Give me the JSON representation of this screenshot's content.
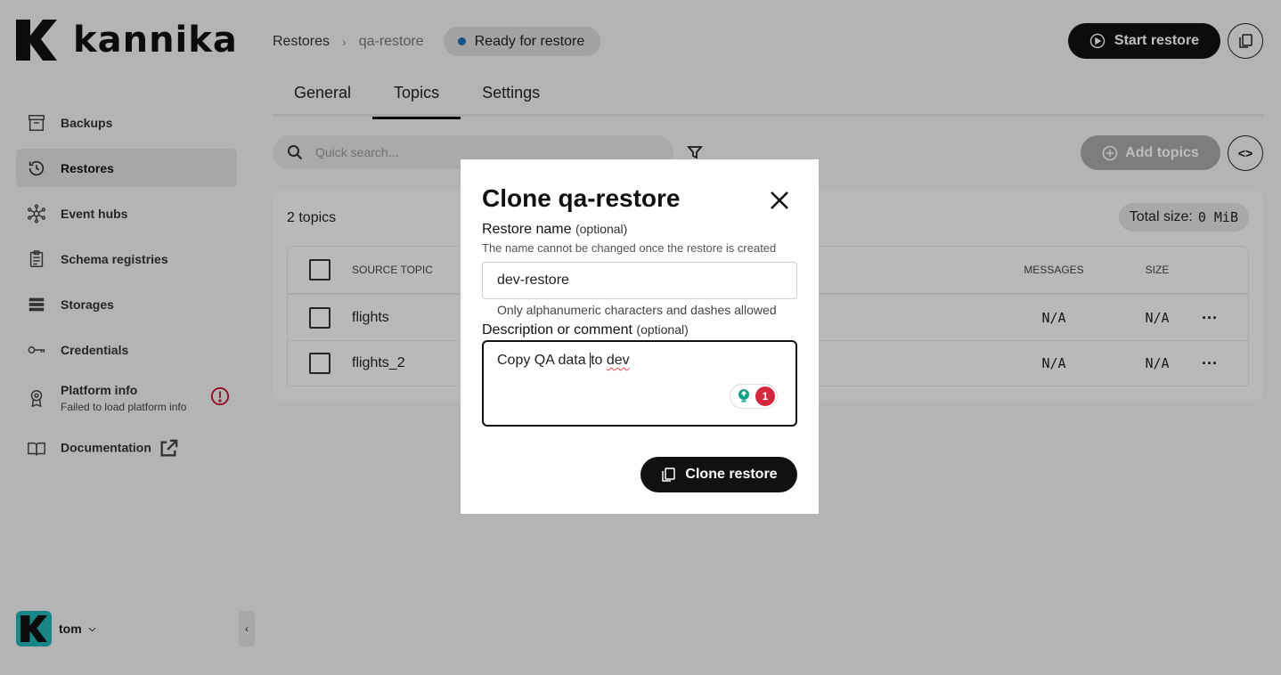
{
  "brand": {
    "name": "kannika"
  },
  "sidebar": {
    "items": [
      {
        "label": "Backups"
      },
      {
        "label": "Restores"
      },
      {
        "label": "Event hubs"
      },
      {
        "label": "Schema registries"
      },
      {
        "label": "Storages"
      },
      {
        "label": "Credentials"
      },
      {
        "label": "Platform info",
        "sub": "Failed to load platform info"
      },
      {
        "label": "Documentation"
      }
    ],
    "user": {
      "name": "tom"
    }
  },
  "header": {
    "breadcrumb": [
      "Restores",
      "qa-restore"
    ],
    "status": "Ready for restore",
    "start_label": "Start restore"
  },
  "tabs": [
    {
      "label": "General"
    },
    {
      "label": "Topics"
    },
    {
      "label": "Settings"
    }
  ],
  "toolbar": {
    "search_placeholder": "Quick search...",
    "add_topics_label": "Add topics"
  },
  "topics": {
    "count_label": "2 topics",
    "total_size_label": "Total size:",
    "total_size_value": "0 MiB",
    "columns": {
      "source": "SOURCE TOPIC",
      "messages": "MESSAGES",
      "size": "SIZE"
    },
    "rows": [
      {
        "name": "flights",
        "messages": "N/A",
        "size": "N/A"
      },
      {
        "name": "flights_2",
        "messages": "N/A",
        "size": "N/A"
      }
    ]
  },
  "modal": {
    "title": "Clone qa-restore",
    "name_label": "Restore name",
    "optional": "(optional)",
    "name_help": "The name cannot be changed once the restore is created",
    "name_value": "dev-restore",
    "name_hint": "Only alphanumeric characters and dashes allowed",
    "desc_label": "Description or comment",
    "desc_part1": "Copy QA data ",
    "desc_part2": "to ",
    "desc_part3": "dev",
    "grammar_count": "1",
    "clone_label": "Clone restore"
  },
  "colors": {
    "accent": "#111111",
    "status_dot": "#1a6fc4",
    "avatar": "#1eb5b5",
    "warning": "#c8102e"
  }
}
